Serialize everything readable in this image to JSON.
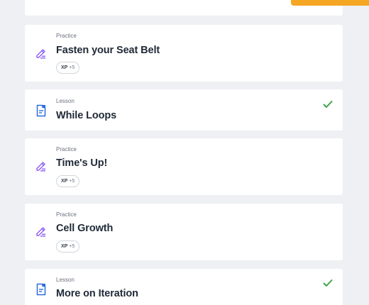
{
  "colors": {
    "background": "#eef0f4",
    "card": "#ffffff",
    "accent_orange": "#f5a623",
    "practice_icon": "#8b5cf6",
    "lesson_icon": "#2b6cd9",
    "check": "#3fa34d"
  },
  "items": [
    {
      "type": "Practice",
      "title": "Fasten your Seat Belt",
      "icon": "pencil-icon",
      "xp_label": "XP",
      "xp_value": "+5",
      "completed": false
    },
    {
      "type": "Lesson",
      "title": "While Loops",
      "icon": "document-icon",
      "completed": true
    },
    {
      "type": "Practice",
      "title": "Time's Up!",
      "icon": "pencil-icon",
      "xp_label": "XP",
      "xp_value": "+5",
      "completed": false
    },
    {
      "type": "Practice",
      "title": "Cell Growth",
      "icon": "pencil-icon",
      "xp_label": "XP",
      "xp_value": "+5",
      "completed": false
    },
    {
      "type": "Lesson",
      "title": "More on Iteration",
      "icon": "document-icon",
      "completed": true
    }
  ]
}
